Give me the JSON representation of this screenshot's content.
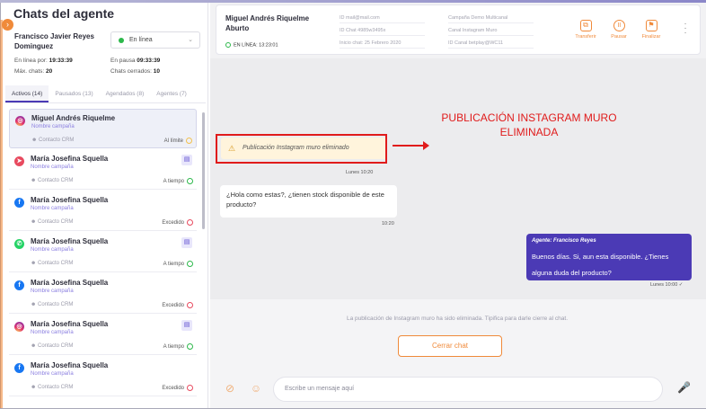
{
  "sidebar": {
    "title": "Chats del agente",
    "agent_name": "Francisco Javier Reyes Dominguez",
    "status": "En línea",
    "stats": {
      "online_label": "En línea por:",
      "online_value": "19:33:39",
      "paused_label": "En pausa",
      "paused_value": "09:33:39",
      "max_label": "Máx. chats:",
      "max_value": "20",
      "closed_label": "Chats cerrados:",
      "closed_value": "10"
    },
    "tabs": [
      "Activos (14)",
      "Pausados (13)",
      "Agendados (8)",
      "Agentes (7)"
    ],
    "chats": [
      {
        "name": "Miguel Andrés Riquelme",
        "campaign": "Nombre campaña",
        "crm": "Contacto CRM",
        "status": "Al límite",
        "channel": "ig",
        "state": "warn",
        "badge": false
      },
      {
        "name": "María Josefina Squella",
        "campaign": "Nombre campaña",
        "crm": "Contacto CRM",
        "status": "A tiempo",
        "channel": "tg",
        "state": "ok",
        "badge": true
      },
      {
        "name": "María Josefina Squella",
        "campaign": "Nombre campaña",
        "crm": "Contacto CRM",
        "status": "Excedido",
        "channel": "fb",
        "state": "err",
        "badge": false
      },
      {
        "name": "María Josefina Squella",
        "campaign": "Nombre campaña",
        "crm": "Contacto CRM",
        "status": "A tiempo",
        "channel": "wa",
        "state": "ok",
        "badge": true
      },
      {
        "name": "María Josefina Squella",
        "campaign": "Nombre campaña",
        "crm": "Contacto CRM",
        "status": "Excedido",
        "channel": "fb",
        "state": "err",
        "badge": false
      },
      {
        "name": "María Josefina Squella",
        "campaign": "Nombre campaña",
        "crm": "Contacto CRM",
        "status": "A tiempo",
        "channel": "ig",
        "state": "ok",
        "badge": true
      },
      {
        "name": "María Josefina Squella",
        "campaign": "Nombre campaña",
        "crm": "Contacto CRM",
        "status": "Excedido",
        "channel": "fb",
        "state": "err",
        "badge": false
      }
    ]
  },
  "header": {
    "contact_name": "Miguel Andrés Riquelme Aburto",
    "online_text": "EN LÍNEA: 13:23:01",
    "fields": [
      "ID mail@mail.com",
      "ID Chat 4985w3495x",
      "Inicio chat: 25 Febrero 2020",
      "Campaña Demo Multicanal",
      "Canal Instagram Muro",
      "ID Canal betplay@WC11"
    ],
    "actions": [
      "Transferir",
      "Pausar",
      "Finalizar"
    ]
  },
  "messages": {
    "removed_text": "Publicación Instagram muro eliminado",
    "removed_time": "Lunes 10:20",
    "incoming_text": "¿Hola como estas?, ¿tienen stock disponible de este producto?",
    "incoming_time": "10:20",
    "agent_label": "Agente: Francisco Reyes",
    "outgoing_text": "Buenos días. Si, aun esta disponible. ¿Tienes alguna duda del producto?",
    "outgoing_time": "Lunes 10:00 ✓"
  },
  "annotation": "PUBLICACIÓN INSTAGRAM MURO ELIMINADA",
  "footer": {
    "info": "La publicación de Instagram muro ha sido eliminada. Tipifica para darle cierre al chat.",
    "close_button": "Cerrar chat",
    "composer_placeholder": "Escribe un mensaje aquí"
  },
  "colors": {
    "accent": "#f08a3a",
    "primary": "#4b3ab5",
    "annotation": "#e01b1b"
  }
}
